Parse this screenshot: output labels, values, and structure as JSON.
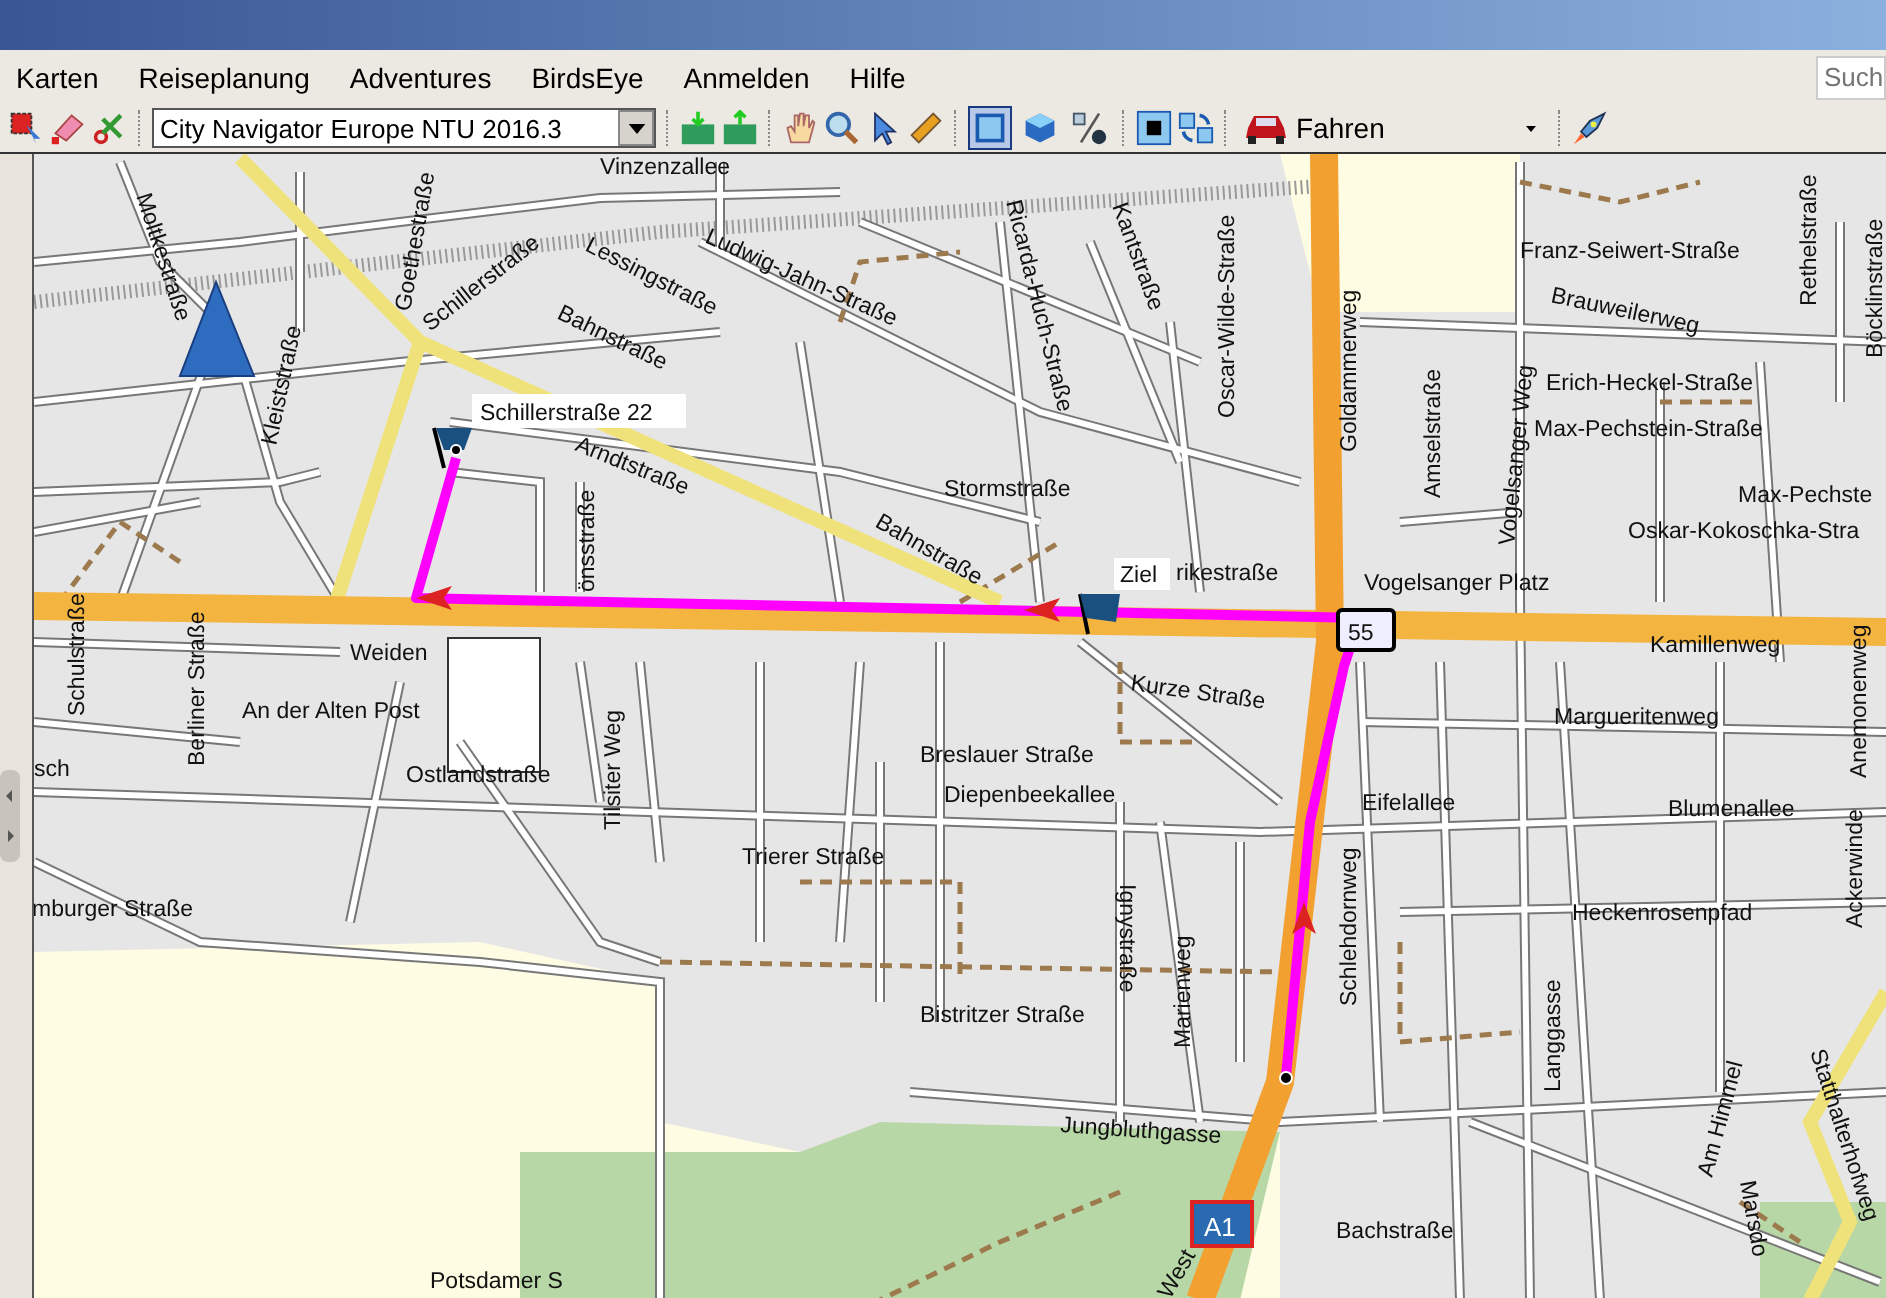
{
  "menu": [
    "Karten",
    "Reiseplanung",
    "Adventures",
    "BirdsEye",
    "Anmelden",
    "Hilfe"
  ],
  "search": {
    "placeholder": "Such"
  },
  "toolbar": {
    "map_product": "City Navigator Europe NTU 2016.3",
    "profile": "Fahren",
    "view_buttons": [
      {
        "kind": "flat",
        "selected": true
      },
      {
        "kind": "cube",
        "selected": false
      },
      {
        "kind": "relief",
        "selected": false
      }
    ]
  },
  "map": {
    "waypoint_label": "Schillerstraße 22",
    "destination_label": "Ziel",
    "shields": [
      {
        "kind": "route",
        "text": "55"
      },
      {
        "kind": "motorway",
        "text": "A1"
      }
    ],
    "labels": [
      "Vinzenzallee",
      "Moltkestraße",
      "Goethestraße",
      "Schillerstraße",
      "Lessingstraße",
      "Ludwig-Jahn-Straße",
      "Ricarda-Huch-Straße",
      "Kantstraße",
      "Oscar-Wilde-Straße",
      "Goldammerweg",
      "Franz-Seiwert-Straße",
      "Rethelstraße",
      "Böcklinstraße",
      "Brauweilerweg",
      "Bahnstraße",
      "Kleiststraße",
      "Arndtstraße",
      "Stormstraße",
      "Amselstraße",
      "Vogelsanger Weg",
      "Erich-Heckel-Straße",
      "Max-Pechstein-Straße",
      "Max-Pechste",
      "Oskar-Kokoschka-Stra",
      "Bahnstraße",
      "önsstraße",
      "rikestraße",
      "Vogelsanger Platz",
      "Schulstraße",
      "Berliner Straße",
      "Weiden",
      "An der Alten Post",
      "Kamillenweg",
      "Kurze Straße",
      "Margueritenweg",
      "Tilsiter Weg",
      "Breslauer Straße",
      "Ostlandstraße",
      "Diepenbeekallee",
      "Eifelallee",
      "Blumenallee",
      "Anemonenweg",
      "Ackerwinde",
      "sch",
      "mburger Straße",
      "Trierer Straße",
      "Heckenrosenpfad",
      "Schlehdornweg",
      "Marienweg",
      "Ignystraße",
      "Bistritzer Straße",
      "Langgasse",
      "Jungbluthgasse",
      "Am Himmel",
      "Marsdo",
      "Statthalterhofweg",
      "Bachstraße",
      "Potsdamer S",
      "West"
    ]
  }
}
